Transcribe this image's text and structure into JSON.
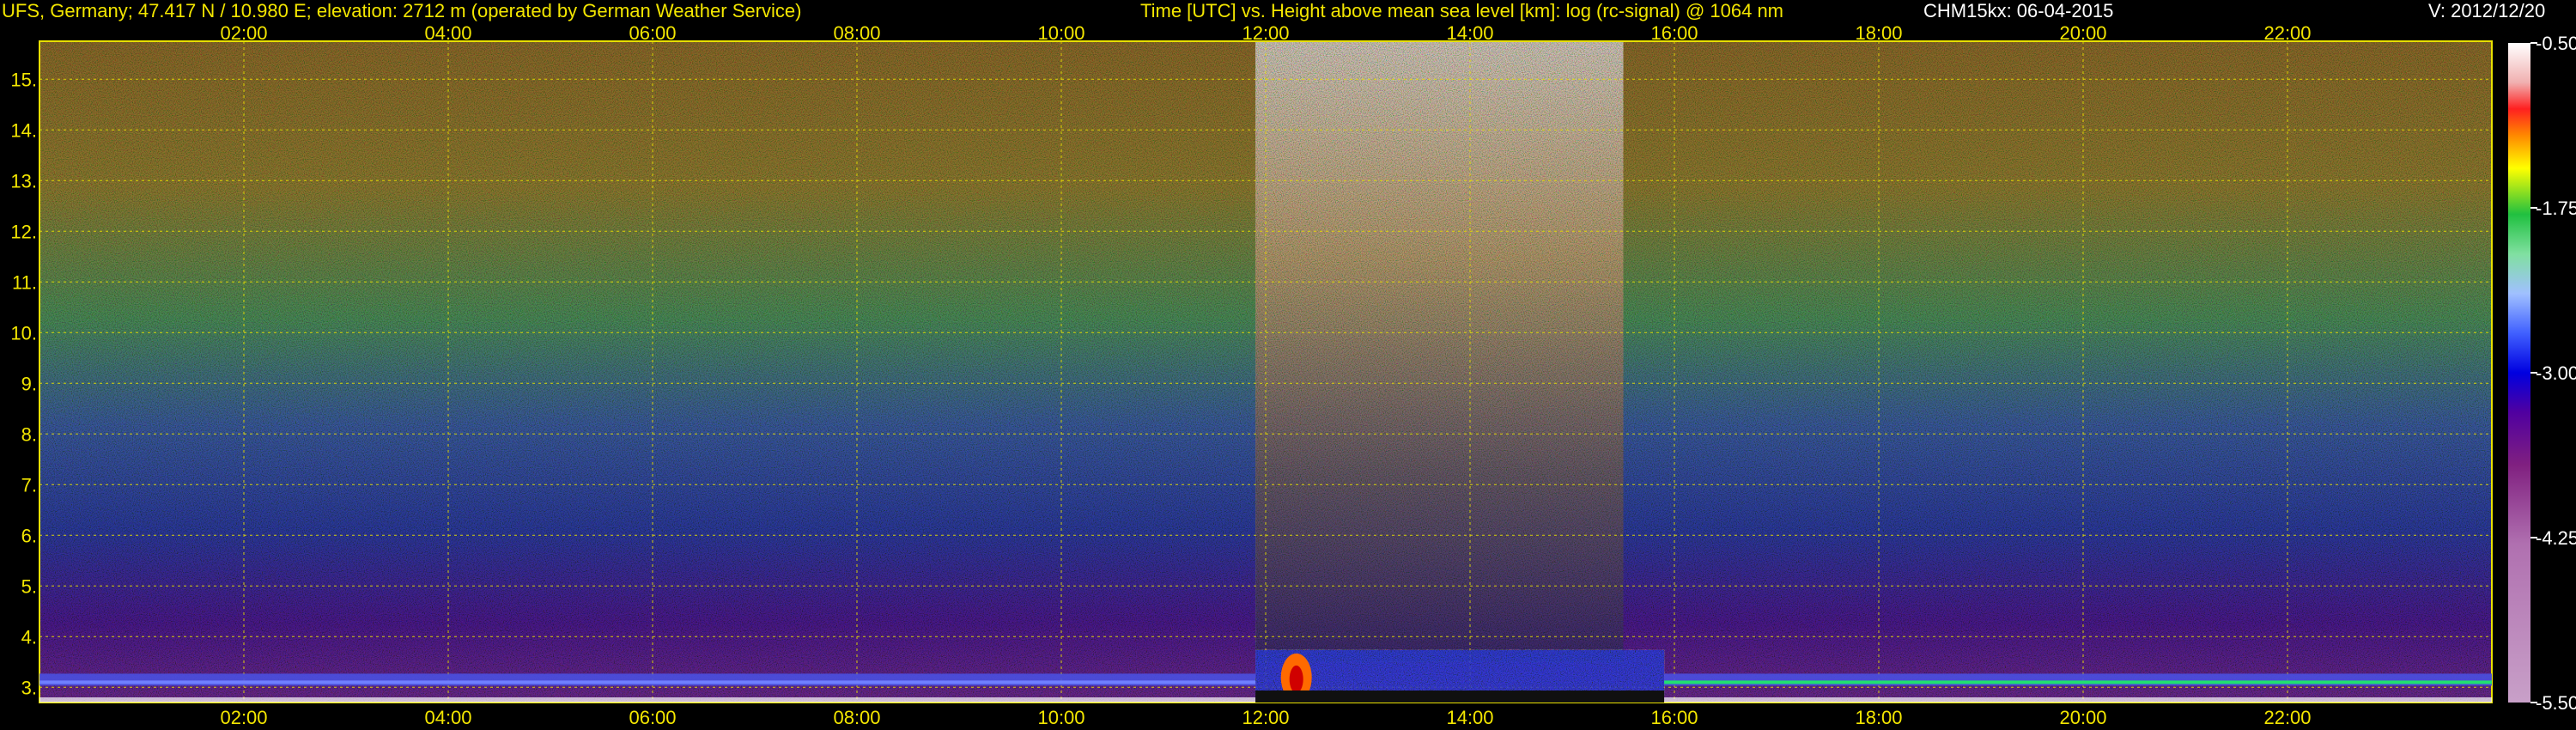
{
  "header": {
    "station": "UFS, Germany; 47.417 N / 10.980 E; elevation: 2712 m  (operated by German Weather Service)",
    "plot_title": "Time [UTC] vs. Height above mean sea level [km]: log (rc-signal) @ 1064 nm",
    "instrument_date": "CHM15kx: 06-04-2015",
    "version": "V: 2012/12/20"
  },
  "colors": {
    "text": "#f3e600",
    "grid": "#e8e000",
    "background": "#000000",
    "frame": "#e8e000"
  },
  "chart_data": {
    "type": "heatmap",
    "title": "Time [UTC] vs. Height above mean sea level [km]: log (rc-signal) @ 1064 nm",
    "x": {
      "unit": "UTC hours",
      "range": [
        0.0,
        24.0
      ],
      "ticks": [
        2,
        4,
        6,
        8,
        10,
        12,
        14,
        16,
        18,
        20,
        22
      ],
      "tick_labels": [
        "02:00",
        "04:00",
        "06:00",
        "08:00",
        "10:00",
        "12:00",
        "14:00",
        "16:00",
        "18:00",
        "20:00",
        "22:00"
      ],
      "label_positions": [
        "top",
        "bottom"
      ]
    },
    "y": {
      "unit": "km",
      "range": [
        2.7,
        15.75
      ],
      "ticks": [
        3,
        4,
        5,
        6,
        7,
        8,
        9,
        10,
        11,
        12,
        13,
        14,
        15
      ],
      "tick_labels": [
        "3.",
        "4.",
        "5.",
        "6.",
        "7.",
        "8.",
        "9.",
        "10.",
        "11.",
        "12.",
        "13.",
        "14.",
        "15."
      ]
    },
    "colorbar": {
      "range": [
        -5.5,
        -0.5
      ],
      "ticks": [
        -0.5,
        -1.75,
        -3.0,
        -4.25,
        -5.5
      ],
      "tick_labels": [
        "-0.50",
        "-1.75",
        "-3.00",
        "-4.25",
        "-5.50"
      ]
    },
    "grid": true,
    "features": [
      {
        "kind": "boundary_layer",
        "t_start": 0.0,
        "t_end": 11.9,
        "height": 3.1,
        "value": -3.2
      },
      {
        "kind": "aerosol_layer",
        "t_start": 11.9,
        "t_end": 15.9,
        "height": 3.6,
        "value": -1.6
      },
      {
        "kind": "boundary_layer",
        "t_start": 15.9,
        "t_end": 24.0,
        "height": 3.1,
        "value": -2.2
      },
      {
        "kind": "high_noise",
        "t_start": 11.9,
        "t_end": 15.5,
        "height_from": 3.5,
        "height_to": 15.75,
        "value": -0.7
      }
    ]
  }
}
